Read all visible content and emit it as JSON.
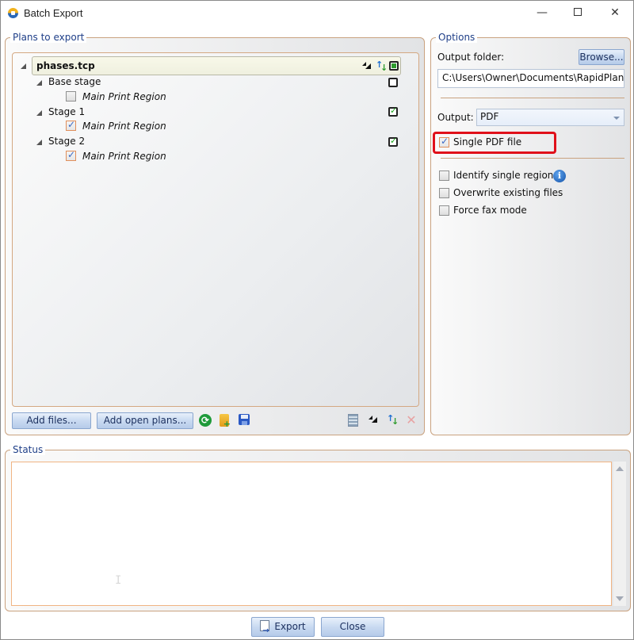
{
  "window": {
    "title": "Batch Export",
    "controls": {
      "minimize": "—",
      "maximize": "",
      "close": "✕"
    }
  },
  "plans": {
    "group_label": "Plans to export",
    "tree": {
      "root": {
        "label": "phases.tcp",
        "checked": "partial"
      },
      "stages": [
        {
          "label": "Base stage",
          "checked": false,
          "regions": [
            {
              "label": "Main Print Region",
              "checked": false
            }
          ]
        },
        {
          "label": "Stage 1",
          "checked": true,
          "regions": [
            {
              "label": "Main Print Region",
              "checked": true
            }
          ]
        },
        {
          "label": "Stage 2",
          "checked": true,
          "regions": [
            {
              "label": "Main Print Region",
              "checked": true
            }
          ]
        }
      ]
    },
    "toolbar": {
      "add_files": "Add files...",
      "add_open_plans": "Add open plans...",
      "icons": [
        "refresh-icon",
        "add-folder-icon",
        "save-icon",
        "grid-icon",
        "collapse-all-icon",
        "sort-icon",
        "delete-icon"
      ]
    }
  },
  "options": {
    "group_label": "Options",
    "output_folder_label": "Output folder:",
    "browse_label": "Browse...",
    "output_folder_value": "C:\\Users\\Owner\\Documents\\RapidPlan\\Pla",
    "output_label": "Output:",
    "output_value": "PDF",
    "single_pdf": {
      "label": "Single PDF file",
      "checked": true
    },
    "identify_single_regions": {
      "label": "Identify single regions",
      "checked": false
    },
    "overwrite_existing": {
      "label": "Overwrite existing files",
      "checked": false
    },
    "force_fax": {
      "label": "Force fax mode",
      "checked": false
    }
  },
  "status": {
    "group_label": "Status",
    "text": ""
  },
  "footer": {
    "export_label": "Export",
    "close_label": "Close"
  },
  "colors": {
    "group_border": "#c9a27f",
    "group_label": "#1f3f88",
    "highlight": "#e0101a",
    "button_top": "#e8f0fb",
    "button_bottom": "#b6cbe9"
  }
}
